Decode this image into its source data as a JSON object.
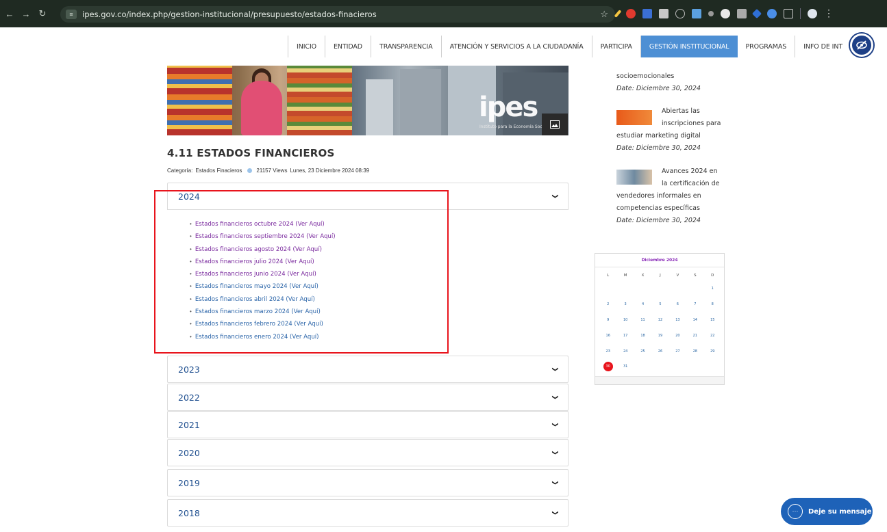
{
  "browser": {
    "url": "ipes.gov.co/index.php/gestion-institucional/presupuesto/estados-finacieros"
  },
  "menu": [
    {
      "label": "INICIO"
    },
    {
      "label": "ENTIDAD"
    },
    {
      "label": "TRANSPARENCIA"
    },
    {
      "label": "ATENCIÓN Y SERVICIOS A LA CIUDADANÍA"
    },
    {
      "label": "PARTICIPA"
    },
    {
      "label": "GESTIÓN INSTITUCIONAL",
      "active": true
    },
    {
      "label": "PROGRAMAS"
    },
    {
      "label": "INFO DE INT"
    }
  ],
  "banner": {
    "logo_text": "ipes",
    "logo_sub": "Instituto para la Economía Social"
  },
  "article": {
    "title": "4.11 ESTADOS FINANCIEROS",
    "category_label": "Categoría:",
    "category_value": "Estados Finacieros",
    "views": "21157 Views",
    "date": "Lunes, 23 Diciembre 2024 08:39"
  },
  "accordion": {
    "open": {
      "year": "2024",
      "links": [
        {
          "text": "Estados financieros octubre 2024 (Ver Aquí)",
          "color": "#7a2a9e"
        },
        {
          "text": "Estados financieros septiembre 2024 (Ver Aquí)",
          "color": "#7a2a9e"
        },
        {
          "text": "Estados financieros agosto 2024 (Ver Aquí)",
          "color": "#7a2a9e"
        },
        {
          "text": "Estados financieros julio 2024 (Ver Aquí)",
          "color": "#7a2a9e"
        },
        {
          "text": "Estados financieros junio 2024 (Ver Aquí)",
          "color": "#7a2a9e"
        },
        {
          "text": "Estados financieros mayo 2024 (Ver Aquí)",
          "color": "#2a64a8"
        },
        {
          "text": "Estados financieros abril 2024 (Ver Aquí)",
          "color": "#2a64a8"
        },
        {
          "text": "Estados financieros marzo 2024 (Ver Aquí)",
          "color": "#2a64a8"
        },
        {
          "text": "Estados financieros febrero 2024 (Ver Aquí)",
          "color": "#2a64a8"
        },
        {
          "text": "Estados financieros enero 2024 (Ver Aquí)",
          "color": "#2a64a8"
        }
      ]
    },
    "closed": [
      "2023",
      "2022",
      "2021",
      "2020",
      "2019",
      "2018"
    ]
  },
  "sidebar": {
    "news": [
      {
        "line1": "socioemocionales",
        "date": "Date: Diciembre 30, 2024"
      },
      {
        "title_a": "Abiertas las",
        "title_b": "inscripciones para",
        "title_c": "estudiar marketing digital",
        "date": "Date: Diciembre 30, 2024"
      },
      {
        "title_a": "Avances 2024 en",
        "title_b": "la certificación de",
        "title_c": "vendedores informales en",
        "title_d": "competencias específicas",
        "date": "Date: Diciembre 30, 2024"
      }
    ]
  },
  "calendar": {
    "title": "Diciembre 2024",
    "dow": [
      "L",
      "M",
      "X",
      "J",
      "V",
      "S",
      "D"
    ],
    "weeks": [
      [
        "",
        "",
        "",
        "",
        "",
        "",
        "1"
      ],
      [
        "2",
        "3",
        "4",
        "5",
        "6",
        "7",
        "8"
      ],
      [
        "9",
        "10",
        "11",
        "12",
        "13",
        "14",
        "15"
      ],
      [
        "16",
        "17",
        "18",
        "19",
        "20",
        "21",
        "22"
      ],
      [
        "23",
        "24",
        "25",
        "26",
        "27",
        "28",
        "29"
      ],
      [
        "30",
        "31",
        "",
        "",
        "",
        "",
        ""
      ]
    ],
    "today": "30"
  },
  "chat": {
    "label": "Deje su mensaje"
  },
  "colors": {
    "menu_active": "#4d8fd4",
    "accordion_year": "#1f4f8f",
    "highlight": "#e8141c",
    "chat": "#1e62b8"
  }
}
